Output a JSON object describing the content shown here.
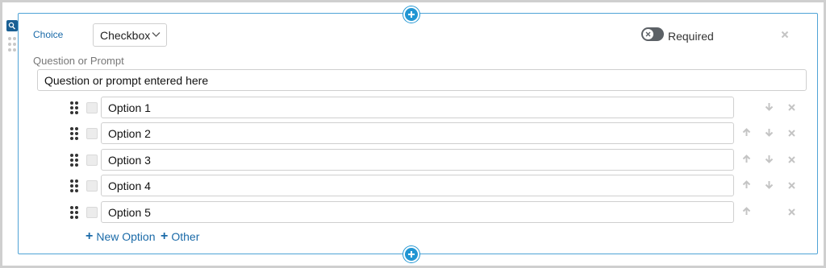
{
  "question": {
    "type_label": "Choice",
    "type_value": "Checkbox",
    "required_label": "Required",
    "required_on": false,
    "prompt_label": "Question or Prompt",
    "prompt_value": "Question or prompt entered here"
  },
  "options": [
    {
      "value": "Option 1",
      "can_up": false,
      "can_down": true
    },
    {
      "value": "Option 2",
      "can_up": true,
      "can_down": true
    },
    {
      "value": "Option 3",
      "can_up": true,
      "can_down": true
    },
    {
      "value": "Option 4",
      "can_up": true,
      "can_down": true
    },
    {
      "value": "Option 5",
      "can_up": true,
      "can_down": false
    }
  ],
  "links": {
    "new_option": "New Option",
    "other": "Other"
  },
  "icons": {
    "question_type": "question-type-icon",
    "add": "plus-circle-icon",
    "drag": "drag-handle-icon",
    "move_up": "arrow-up-icon",
    "move_down": "arrow-down-icon",
    "delete": "close-icon",
    "toggle": "toggle-off-icon"
  },
  "colors": {
    "accent": "#2196d3",
    "card_border": "#4fa3d6",
    "link": "#1a6aa8",
    "toggle_off": "#5c6166",
    "muted_icon": "#c4c4c4"
  }
}
